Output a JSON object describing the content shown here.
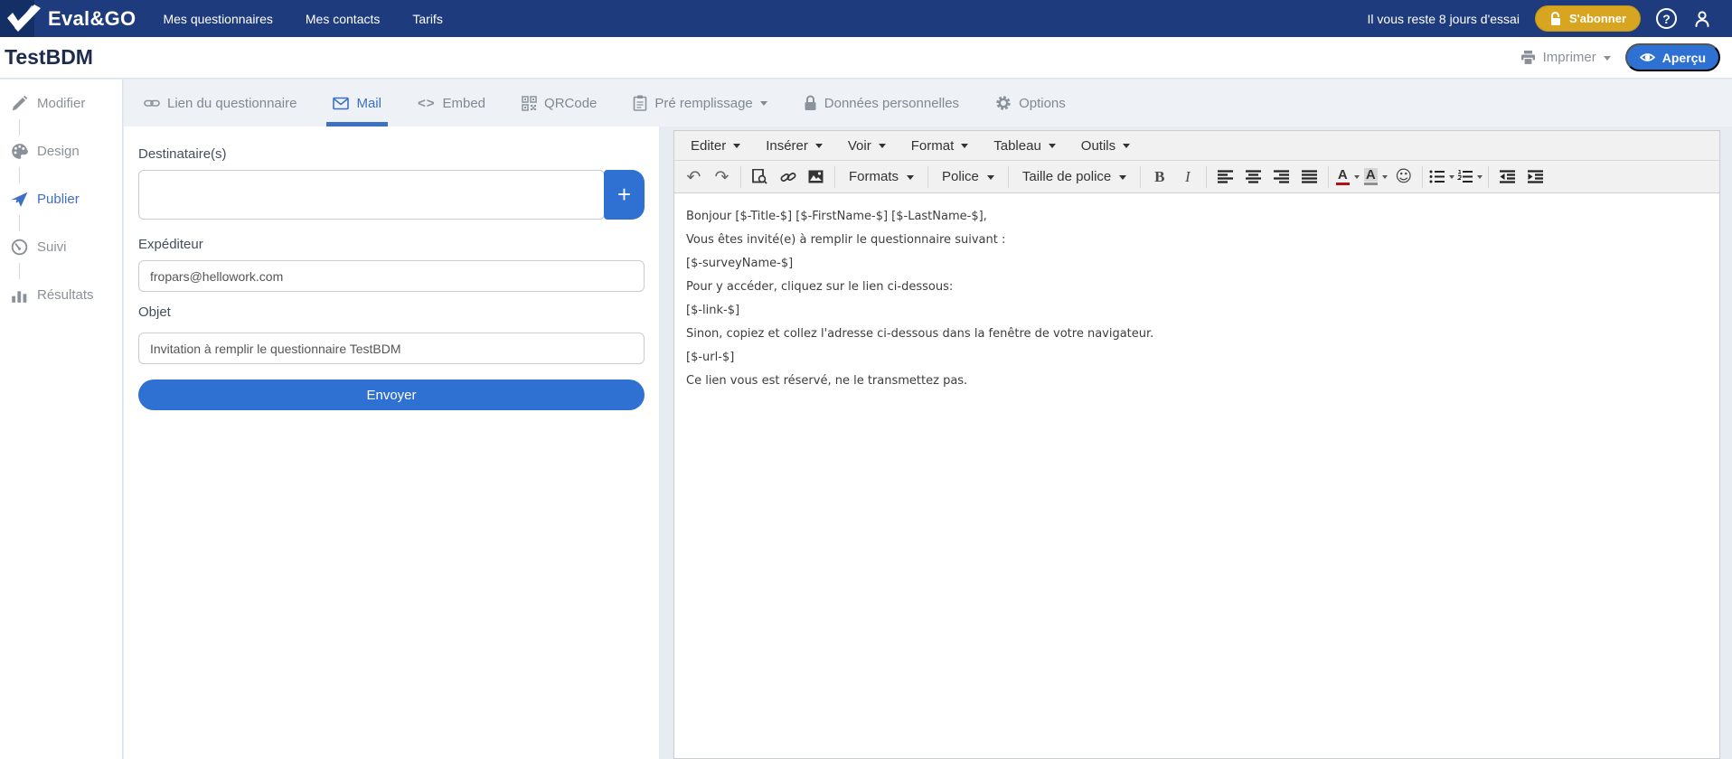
{
  "navbar": {
    "brand": "Eval&GO",
    "menu": [
      "Mes questionnaires",
      "Mes contacts",
      "Tarifs"
    ],
    "trial_text": "Il vous reste 8 jours d'essai",
    "subscribe_label": "S'abonner",
    "help_glyph": "?"
  },
  "titlebar": {
    "title": "TestBDM",
    "print_label": "Imprimer",
    "preview_label": "Aperçu"
  },
  "sidebar": {
    "items": [
      {
        "label": "Modifier",
        "icon": "pencil-icon",
        "active": false
      },
      {
        "label": "Design",
        "icon": "palette-icon",
        "active": false
      },
      {
        "label": "Publier",
        "icon": "paper-plane-icon",
        "active": true
      },
      {
        "label": "Suivi",
        "icon": "gauge-icon",
        "active": false
      },
      {
        "label": "Résultats",
        "icon": "bar-chart-icon",
        "active": false
      }
    ]
  },
  "tabs": [
    {
      "label": "Lien du questionnaire",
      "icon": "link-icon",
      "active": false
    },
    {
      "label": "Mail",
      "icon": "envelope-icon",
      "active": true
    },
    {
      "label": "Embed",
      "icon": "code-icon",
      "active": false
    },
    {
      "label": "QRCode",
      "icon": "qrcode-icon",
      "active": false
    },
    {
      "label": "Pré remplissage",
      "icon": "clipboard-icon",
      "active": false,
      "dropdown": true
    },
    {
      "label": "Données personnelles",
      "icon": "lock-icon",
      "active": false
    },
    {
      "label": "Options",
      "icon": "gear-icon",
      "active": false
    }
  ],
  "form": {
    "recipients_label": "Destinataire(s)",
    "recipients_value": "",
    "add_button_label": "+",
    "sender_label": "Expéditeur",
    "sender_value": "fropars@hellowork.com",
    "subject_label": "Objet",
    "subject_value": "Invitation à remplir le questionnaire TestBDM",
    "send_label": "Envoyer"
  },
  "editor": {
    "menubar": [
      "Editer",
      "Insérer",
      "Voir",
      "Format",
      "Tableau",
      "Outils"
    ],
    "toolbar": {
      "formats_label": "Formats",
      "font_label": "Police",
      "font_size_label": "Taille de police",
      "bold_label": "B",
      "italic_label": "I",
      "forecolor_letter": "A",
      "backcolor_letter": "A"
    },
    "body": [
      "Bonjour [$-Title-$] [$-FirstName-$] [$-LastName-$],",
      "Vous êtes invité(e) à remplir le questionnaire suivant :",
      "[$-surveyName-$]",
      "Pour y accéder, cliquez sur le lien ci-dessous:",
      "[$-link-$]",
      "Sinon, copiez et collez l'adresse ci-dessous dans la fenêtre de votre navigateur.",
      "[$-url-$]",
      "Ce lien vous est réservé, ne le transmettez pas."
    ]
  },
  "icons": {
    "undo": "↶",
    "redo": "↷",
    "smiley": "☺",
    "embed": "<>"
  },
  "colors": {
    "navbar_blue": "#1e3c7d",
    "accent_blue": "#3b70c4",
    "button_blue": "#2e71d2",
    "subscribe_gold": "#d7a51f"
  }
}
